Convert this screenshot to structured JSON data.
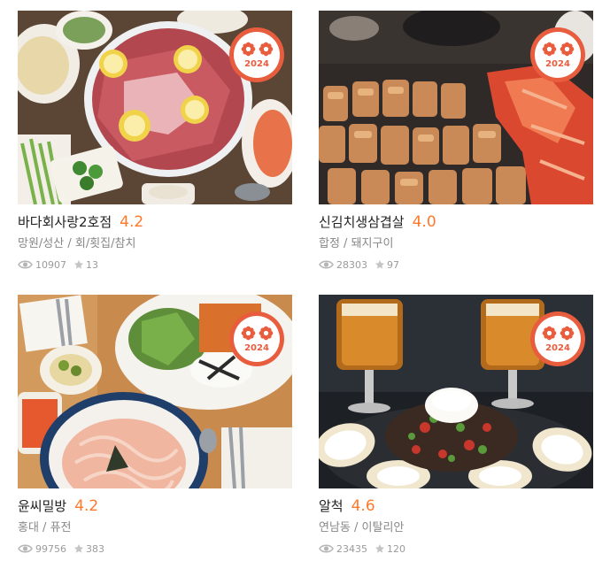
{
  "badge_year": "2024",
  "restaurants": [
    {
      "name": "바다회사랑2호점",
      "score": "4.2",
      "meta": "망원/성산 / 회/횟집/참치",
      "views": "10907",
      "reviews": "13"
    },
    {
      "name": "신김치생삼겹살",
      "score": "4.0",
      "meta": "합정 / 돼지구이",
      "views": "28303",
      "reviews": "97"
    },
    {
      "name": "윤씨밀방",
      "score": "4.2",
      "meta": "홍대 / 퓨전",
      "views": "99756",
      "reviews": "383"
    },
    {
      "name": "알척",
      "score": "4.6",
      "meta": "연남동 / 이탈리안",
      "views": "23435",
      "reviews": "120"
    }
  ],
  "colors": {
    "accent": "#ff792a",
    "badge": "#e95d3f"
  },
  "icons": {
    "views": "eye-icon",
    "reviews": "star-icon",
    "badge": "award-badge-icon"
  }
}
